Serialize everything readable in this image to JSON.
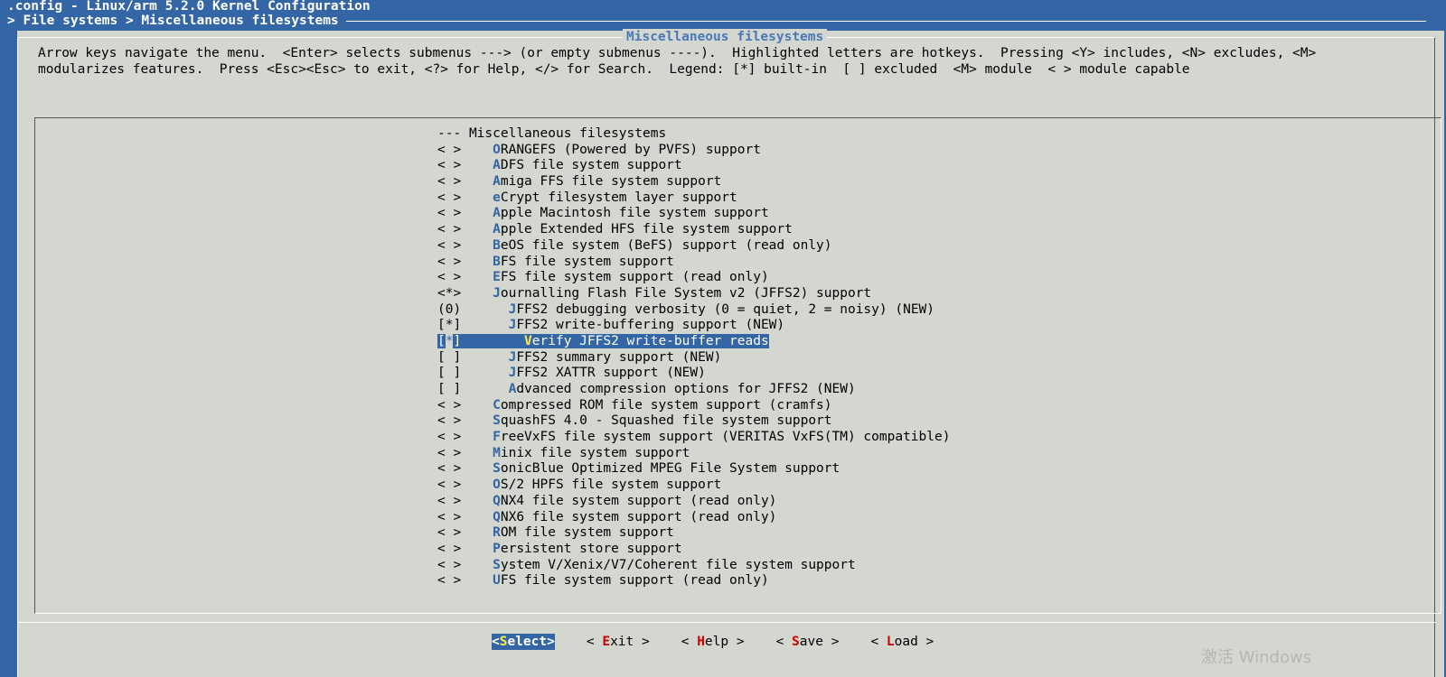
{
  "window": {
    "title": ".config - Linux/arm 5.2.0 Kernel Configuration",
    "breadcrumb": "> File systems > Miscellaneous filesystems"
  },
  "dialog": {
    "title": "Miscellaneous filesystems",
    "help_line1": "Arrow keys navigate the menu.  <Enter> selects submenus ---> (or empty submenus ----).  Highlighted letters are hotkeys.  Pressing <Y> includes, <N> excludes, <M>",
    "help_line2": "modularizes features.  Press <Esc><Esc> to exit, <?> for Help, </> for Search.  Legend: [*] built-in  [ ] excluded  <M> module  < > module capable"
  },
  "menu": {
    "items": [
      {
        "state": "---",
        "indent": "",
        "hotkey": "",
        "label": "Miscellaneous filesystems"
      },
      {
        "state": "< >",
        "indent": "  ",
        "hotkey": "O",
        "label": "RANGEFS (Powered by PVFS) support"
      },
      {
        "state": "< >",
        "indent": "  ",
        "hotkey": "A",
        "label": "DFS file system support"
      },
      {
        "state": "< >",
        "indent": "  ",
        "hotkey": "A",
        "label": "miga FFS file system support"
      },
      {
        "state": "< >",
        "indent": "  ",
        "hotkey": "e",
        "label": "Crypt filesystem layer support"
      },
      {
        "state": "< >",
        "indent": "  ",
        "hotkey": "A",
        "label": "pple Macintosh file system support"
      },
      {
        "state": "< >",
        "indent": "  ",
        "hotkey": "A",
        "label": "pple Extended HFS file system support"
      },
      {
        "state": "< >",
        "indent": "  ",
        "hotkey": "B",
        "label": "eOS file system (BeFS) support (read only)"
      },
      {
        "state": "< >",
        "indent": "  ",
        "hotkey": "B",
        "label": "FS file system support"
      },
      {
        "state": "< >",
        "indent": "  ",
        "hotkey": "E",
        "label": "FS file system support (read only)"
      },
      {
        "state": "<*>",
        "indent": "  ",
        "hotkey": "J",
        "label": "ournalling Flash File System v2 (JFFS2) support"
      },
      {
        "state": "(0)",
        "indent": "    ",
        "hotkey": "J",
        "label": "FFS2 debugging verbosity (0 = quiet, 2 = noisy) (NEW)"
      },
      {
        "state": "[*]",
        "indent": "    ",
        "hotkey": "J",
        "label": "FFS2 write-buffering support (NEW)"
      },
      {
        "state": "[*]",
        "indent": "      ",
        "hotkey": "V",
        "label": "erify JFFS2 write-buffer reads",
        "selected": true
      },
      {
        "state": "[ ]",
        "indent": "    ",
        "hotkey": "J",
        "label": "FFS2 summary support (NEW)"
      },
      {
        "state": "[ ]",
        "indent": "    ",
        "hotkey": "J",
        "label": "FFS2 XATTR support (NEW)"
      },
      {
        "state": "[ ]",
        "indent": "    ",
        "hotkey": "A",
        "label": "dvanced compression options for JFFS2 (NEW)"
      },
      {
        "state": "< >",
        "indent": "  ",
        "hotkey": "C",
        "label": "ompressed ROM file system support (cramfs)"
      },
      {
        "state": "< >",
        "indent": "  ",
        "hotkey": "S",
        "label": "quashFS 4.0 - Squashed file system support"
      },
      {
        "state": "< >",
        "indent": "  ",
        "hotkey": "F",
        "label": "reeVxFS file system support (VERITAS VxFS(TM) compatible)"
      },
      {
        "state": "< >",
        "indent": "  ",
        "hotkey": "M",
        "label": "inix file system support"
      },
      {
        "state": "< >",
        "indent": "  ",
        "hotkey": "S",
        "label": "onicBlue Optimized MPEG File System support"
      },
      {
        "state": "< >",
        "indent": "  ",
        "hotkey": "O",
        "label": "S/2 HPFS file system support"
      },
      {
        "state": "< >",
        "indent": "  ",
        "hotkey": "Q",
        "label": "NX4 file system support (read only)"
      },
      {
        "state": "< >",
        "indent": "  ",
        "hotkey": "Q",
        "label": "NX6 file system support (read only)"
      },
      {
        "state": "< >",
        "indent": "  ",
        "hotkey": "R",
        "label": "OM file system support"
      },
      {
        "state": "< >",
        "indent": "  ",
        "hotkey": "P",
        "label": "ersistent store support"
      },
      {
        "state": "< >",
        "indent": "  ",
        "hotkey": "S",
        "label": "ystem V/Xenix/V7/Coherent file system support"
      },
      {
        "state": "< >",
        "indent": "  ",
        "hotkey": "U",
        "label": "FS file system support (read only)"
      }
    ]
  },
  "buttons": [
    {
      "pre": "<",
      "hotkey": "S",
      "rest": "elect>",
      "active": true
    },
    {
      "pre": "< ",
      "hotkey": "E",
      "rest": "xit >"
    },
    {
      "pre": "< ",
      "hotkey": "H",
      "rest": "elp >"
    },
    {
      "pre": "< ",
      "hotkey": "S",
      "rest": "ave >"
    },
    {
      "pre": "< ",
      "hotkey": "L",
      "rest": "oad >"
    }
  ],
  "watermark": "激活 Windows",
  "colors": {
    "terminal_bg": "#3465a4",
    "dialog_bg": "#d3d7cf",
    "hotkey": "#3465a4",
    "button_hotkey": "#cc0000",
    "selected_hotkey": "#fce94f"
  }
}
